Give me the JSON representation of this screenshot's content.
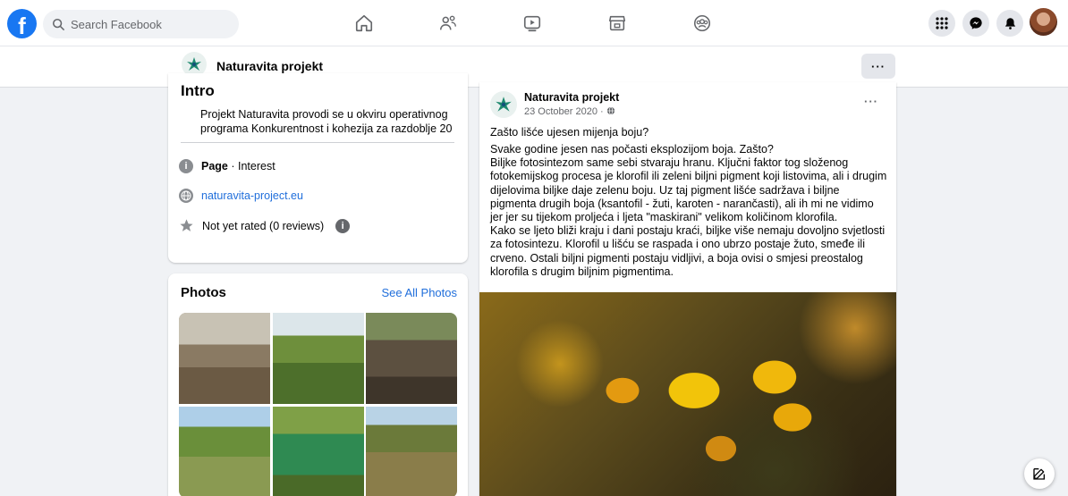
{
  "topnav": {
    "logo": "f",
    "search_placeholder": "Search Facebook",
    "icons": [
      "home-icon",
      "friends-icon",
      "watch-icon",
      "marketplace-icon",
      "groups-icon",
      "menu-grid-icon",
      "messenger-icon",
      "notifications-icon",
      "profile-avatar"
    ]
  },
  "page": {
    "name": "Naturavita projekt",
    "more": "···"
  },
  "intro": {
    "title": "Intro",
    "description": "Projekt Naturavita provodi se u okviru operativnog programa Konkurentnost i kohezija za razdoblje 20",
    "category_label": "Page",
    "category_value": "· Interest",
    "website": "naturavita-project.eu",
    "rating": "Not yet rated (0 reviews)"
  },
  "photos": {
    "title": "Photos",
    "see_all": "See All Photos"
  },
  "post": {
    "author": "Naturavita projekt",
    "date": "23 October 2020 · ",
    "more": "···",
    "question": "Zašto lišće ujesen mijenja boju?",
    "body": "Svake godine jesen nas počasti eksplozijom boja. Zašto?\nBiljke fotosintezom same sebi stvaraju hranu. Ključni faktor tog složenog fotokemijskog procesa je klorofil ili zeleni biljni pigment koji listovima, ali i drugim dijelovima biljke daje zelenu boju. Uz taj pigment lišće sadržava i biljne pigmenta drugih boja (ksantofil - žuti, karoten - narančasti), ali ih mi ne vidimo jer jer su tijekom proljeća i ljeta \"maskirani\" velikom količinom klorofila.\nKako se ljeto bliži kraju i dani postaju kraći, biljke više nemaju dovoljno svjetlosti za fotosintezu. Klorofil u lišću se raspada i ono ubrzo postaje žuto, smeđe ili crveno. Ostali biljni pigmenti postaju vidljivi, a boja ovisi o smjesi preostalog klorofila s drugim biljnim pigmentima."
  },
  "colors": {
    "brand": "#1877f2",
    "link": "#216fdb",
    "background": "#f0f2f5"
  }
}
